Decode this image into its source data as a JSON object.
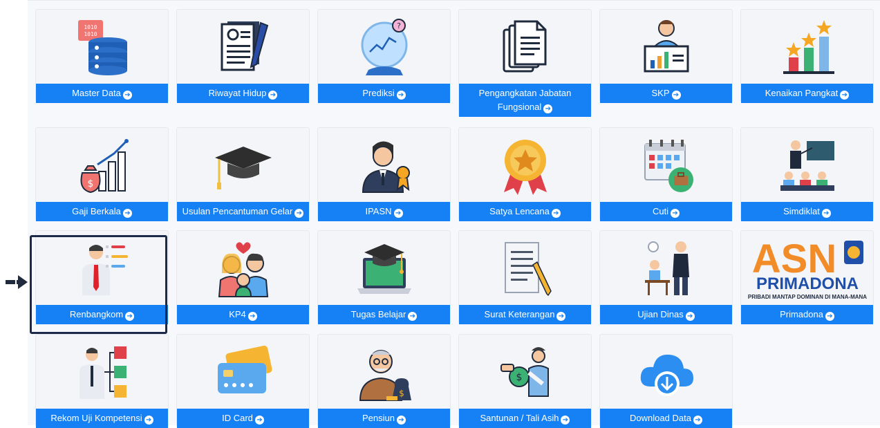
{
  "tiles": [
    {
      "label": "Master Data",
      "icon": "database-icon"
    },
    {
      "label": "Riwayat Hidup",
      "icon": "resume-icon"
    },
    {
      "label": "Prediksi",
      "icon": "crystal-ball-icon"
    },
    {
      "label": "Pengangkatan Jabatan Fungsional",
      "icon": "documents-icon"
    },
    {
      "label": "SKP",
      "icon": "presenter-chart-icon"
    },
    {
      "label": "Kenaikan Pangkat",
      "icon": "star-bars-icon"
    },
    {
      "label": "Gaji Berkala",
      "icon": "money-growth-icon"
    },
    {
      "label": "Usulan Pencantuman Gelar",
      "icon": "graduation-cap-icon"
    },
    {
      "label": "IPASN",
      "icon": "employee-badge-icon"
    },
    {
      "label": "Satya Lencana",
      "icon": "medal-icon"
    },
    {
      "label": "Cuti",
      "icon": "calendar-suitcase-icon"
    },
    {
      "label": "Simdiklat",
      "icon": "training-class-icon"
    },
    {
      "label": "Renbangkom",
      "icon": "profile-card-icon"
    },
    {
      "label": "KP4",
      "icon": "family-icon"
    },
    {
      "label": "Tugas Belajar",
      "icon": "laptop-cap-icon"
    },
    {
      "label": "Surat Keterangan",
      "icon": "letter-pencil-icon"
    },
    {
      "label": "Ujian Dinas",
      "icon": "exam-icon"
    },
    {
      "label": "Primadona",
      "icon": "asn-primadona-logo"
    },
    {
      "label": "Rekom Uji Kompetensi",
      "icon": "competency-flow-icon"
    },
    {
      "label": "ID Card",
      "icon": "id-card-icon"
    },
    {
      "label": "Pensiun",
      "icon": "retiree-icon"
    },
    {
      "label": "Santunan / Tali Asih",
      "icon": "compensation-icon"
    },
    {
      "label": "Download Data",
      "icon": "cloud-download-icon"
    }
  ],
  "primadona_logo": {
    "line1": "ASN",
    "line2": "PRIMADONA",
    "tagline": "PRIBADI MANTAP DOMINAN DI MANA-MANA"
  },
  "arrow_glyph": "➔",
  "colors": {
    "label_bg": "#1581f5",
    "selection_border": "#1b2a4a"
  }
}
